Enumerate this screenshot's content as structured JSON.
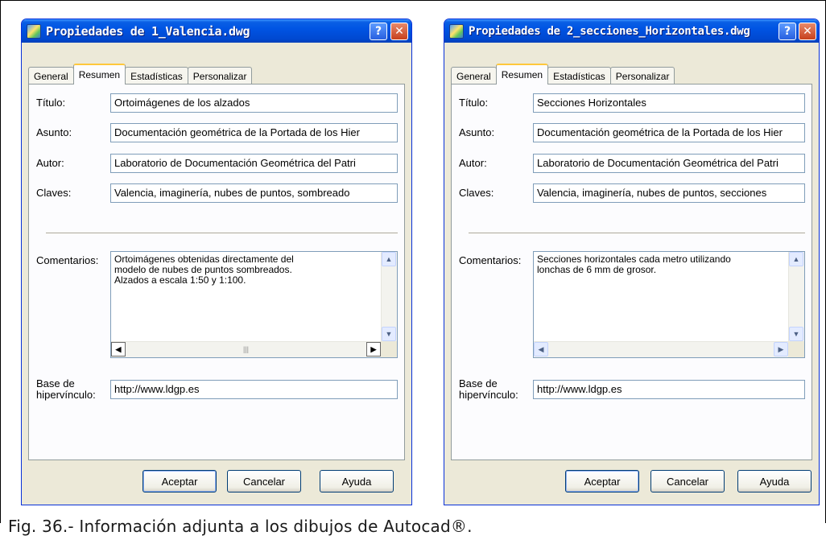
{
  "figure": {
    "caption": "Fig. 36.- Información adjunta a los dibujos de Autocad®."
  },
  "dialogs": [
    {
      "title": "Propiedades de 1_Valencia.dwg",
      "tabs": [
        "General",
        "Resumen",
        "Estadísticas",
        "Personalizar"
      ],
      "active_tab": "Resumen",
      "labels": {
        "title": "Título:",
        "subject": "Asunto:",
        "author": "Autor:",
        "keywords": "Claves:",
        "comments": "Comentarios:",
        "hyperlink_base": "Base de\nhipervínculo:"
      },
      "fields": {
        "title": "Ortoimágenes de los alzados",
        "subject": "Documentación geométrica de la Portada de los Hier",
        "author": "Laboratorio de Documentación Geométrica del Patri",
        "keywords": "Valencia, imaginería, nubes de puntos, sombreado",
        "comments": "Ortoimágenes obtenidas directamente del\nmodelo de nubes de puntos sombreados.\nAlzados a escala 1:50 y 1:100.",
        "hyperlink_base": "http://www.ldgp.es"
      },
      "buttons": {
        "ok": "Aceptar",
        "cancel": "Cancelar",
        "help": "Ayuda"
      }
    },
    {
      "title": "Propiedades de 2_secciones_Horizontales.dwg",
      "tabs": [
        "General",
        "Resumen",
        "Estadísticas",
        "Personalizar"
      ],
      "active_tab": "Resumen",
      "labels": {
        "title": "Título:",
        "subject": "Asunto:",
        "author": "Autor:",
        "keywords": "Claves:",
        "comments": "Comentarios:",
        "hyperlink_base": "Base de\nhipervínculo:"
      },
      "fields": {
        "title": "Secciones Horizontales",
        "subject": "Documentación geométrica de la Portada de los Hier",
        "author": "Laboratorio de Documentación Geométrica del Patri",
        "keywords": "Valencia, imaginería, nubes de puntos, secciones",
        "comments": "Secciones horizontales cada metro utilizando\nlonchas de 6 mm de grosor.",
        "hyperlink_base": "http://www.ldgp.es"
      },
      "buttons": {
        "ok": "Aceptar",
        "cancel": "Cancelar",
        "help": "Ayuda"
      }
    }
  ],
  "colors": {
    "titlebar": "#0054e3",
    "dialog_bg": "#ece9d8",
    "active_tab_accent": "#ffc83c",
    "close_button": "#c7401c"
  }
}
